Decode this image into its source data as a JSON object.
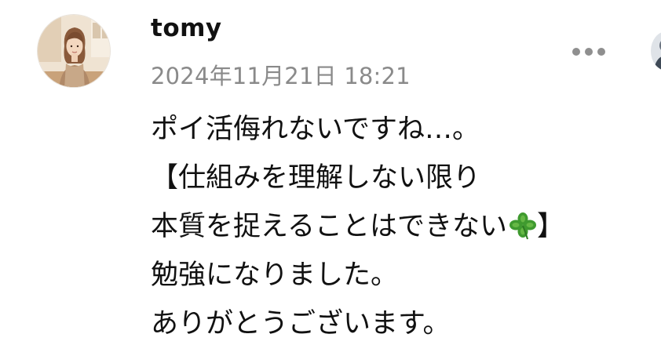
{
  "comment": {
    "author": "tomy",
    "timestamp": "2024年11月21日 18:21",
    "lines": [
      "ポイ活侮れないですね…。",
      "【仕組みを理解しない限り",
      "本質を捉えることはできない",
      "】",
      "勉強になりました。",
      "ありがとうございます。"
    ]
  },
  "icons": {
    "avatar": "avatar-woman-illustration",
    "more": "more-horizontal-icon",
    "clover": "four-leaf-clover-icon"
  },
  "colors": {
    "text": "#111111",
    "timestamp": "#8a8a8a",
    "more_dots": "#8f8f8f",
    "clover": "#3f9a2f"
  }
}
